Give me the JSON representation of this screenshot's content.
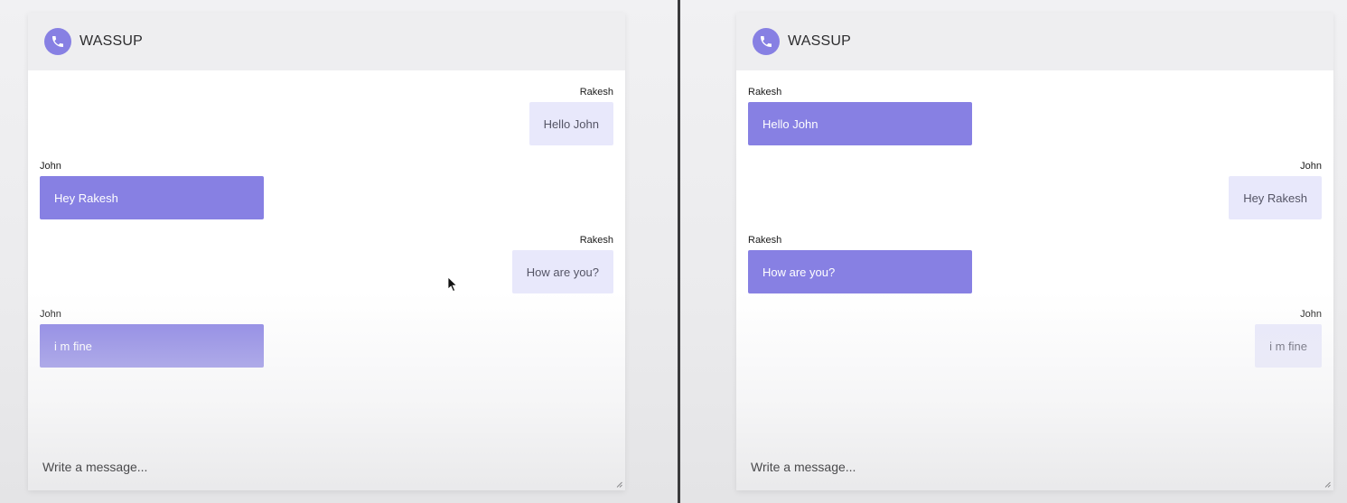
{
  "colors": {
    "accent": "#8780e3",
    "bubble_light": "#e8e8fb",
    "header_bg": "#eeeef0",
    "divider": "#3a3a3c"
  },
  "left_window": {
    "header": {
      "icon": "phone-icon",
      "title": "WASSUP"
    },
    "messages": [
      {
        "sender": "Rakesh",
        "text": "Hello John",
        "side": "right",
        "style": "light"
      },
      {
        "sender": "John",
        "text": "Hey Rakesh",
        "side": "left",
        "style": "dark"
      },
      {
        "sender": "Rakesh",
        "text": "How are you?",
        "side": "right",
        "style": "light"
      },
      {
        "sender": "John",
        "text": "i m fine",
        "side": "left",
        "style": "dark"
      }
    ],
    "composer": {
      "placeholder": "Write a message...",
      "value": ""
    }
  },
  "right_window": {
    "header": {
      "icon": "phone-icon",
      "title": "WASSUP"
    },
    "messages": [
      {
        "sender": "Rakesh",
        "text": "Hello John",
        "side": "left",
        "style": "dark"
      },
      {
        "sender": "John",
        "text": "Hey Rakesh",
        "side": "right",
        "style": "light"
      },
      {
        "sender": "Rakesh",
        "text": "How are you?",
        "side": "left",
        "style": "dark"
      },
      {
        "sender": "John",
        "text": "i m fine",
        "side": "right",
        "style": "light"
      }
    ],
    "composer": {
      "placeholder": "Write a message...",
      "value": ""
    }
  }
}
